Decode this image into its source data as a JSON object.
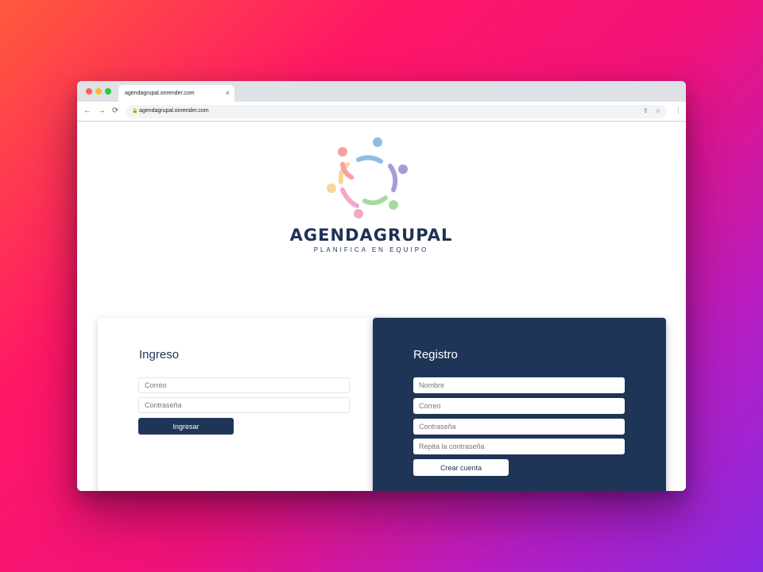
{
  "browser": {
    "tab_title": "agendagrupal.onrender.com",
    "tab_close": "×",
    "url": "agendagrupal.onrender.com",
    "back": "←",
    "forward": "→",
    "reload": "⟳",
    "lock": "🔒",
    "share": "⇪",
    "star": "☆",
    "menu": "⋮"
  },
  "logo": {
    "name": "AGENDAGRUPAL",
    "tagline": "PLANIFICA EN EQUIPO",
    "colors": [
      "#8fbce6",
      "#a99bd9",
      "#a8d9a0",
      "#f2a8c8",
      "#f9d79a",
      "#f4a2a0"
    ]
  },
  "login": {
    "title": "Ingreso",
    "email_placeholder": "Correo",
    "password_placeholder": "Contraseña",
    "submit_label": "Ingresar"
  },
  "register": {
    "title": "Registro",
    "name_placeholder": "Nombre",
    "email_placeholder": "Correo",
    "password_placeholder": "Contraseña",
    "repeat_password_placeholder": "Repita la contraseña",
    "submit_label": "Crear cuenta"
  },
  "colors": {
    "brand_navy": "#1f3557",
    "background_gradient_start": "#ff5a3c",
    "background_gradient_end": "#8a2be2"
  }
}
